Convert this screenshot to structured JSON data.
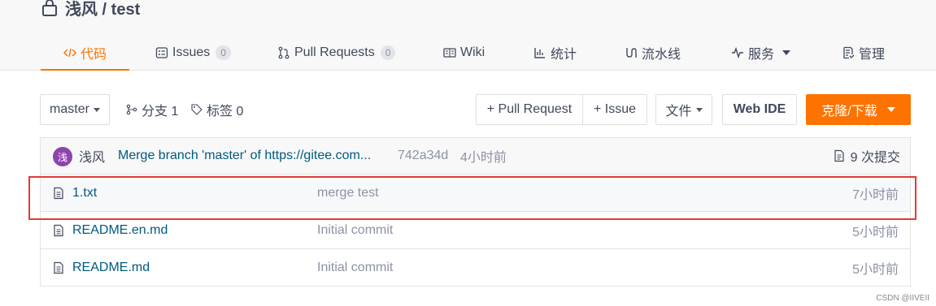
{
  "repo": {
    "title": "浅风 / test"
  },
  "tabs": [
    {
      "label": "代码",
      "icon": "code-icon"
    },
    {
      "label": "Issues",
      "count": "0",
      "icon": "issues-icon"
    },
    {
      "label": "Pull Requests",
      "count": "0",
      "icon": "pull-request-icon"
    },
    {
      "label": "Wiki",
      "icon": "wiki-icon"
    },
    {
      "label": "统计",
      "icon": "stats-icon"
    },
    {
      "label": "流水线",
      "icon": "pipeline-icon"
    },
    {
      "label": "服务",
      "icon": "service-icon"
    },
    {
      "label": "管理",
      "icon": "manage-icon"
    }
  ],
  "toolbar": {
    "branch": "master",
    "branches_label": "分支 1",
    "tags_label": "标签 0",
    "pull_request": "+ Pull Request",
    "issue": "+ Issue",
    "file": "文件",
    "web_ide": "Web IDE",
    "clone": "克隆/下载"
  },
  "latest_commit": {
    "avatar_char": "浅",
    "author": "浅风",
    "message": "Merge branch 'master' of https://gitee.com...",
    "sha": "742a34d",
    "time": "4小时前",
    "count_label": "9 次提交"
  },
  "files": [
    {
      "name": "1.txt",
      "message": "merge test",
      "time": "7小时前"
    },
    {
      "name": "README.en.md",
      "message": "Initial commit",
      "time": "5小时前"
    },
    {
      "name": "README.md",
      "message": "Initial commit",
      "time": "5小时前"
    }
  ],
  "colors": {
    "accent": "#fe7300",
    "link": "#005980",
    "highlight_border": "#e53935"
  },
  "watermark": "CSDN @IIVEII"
}
